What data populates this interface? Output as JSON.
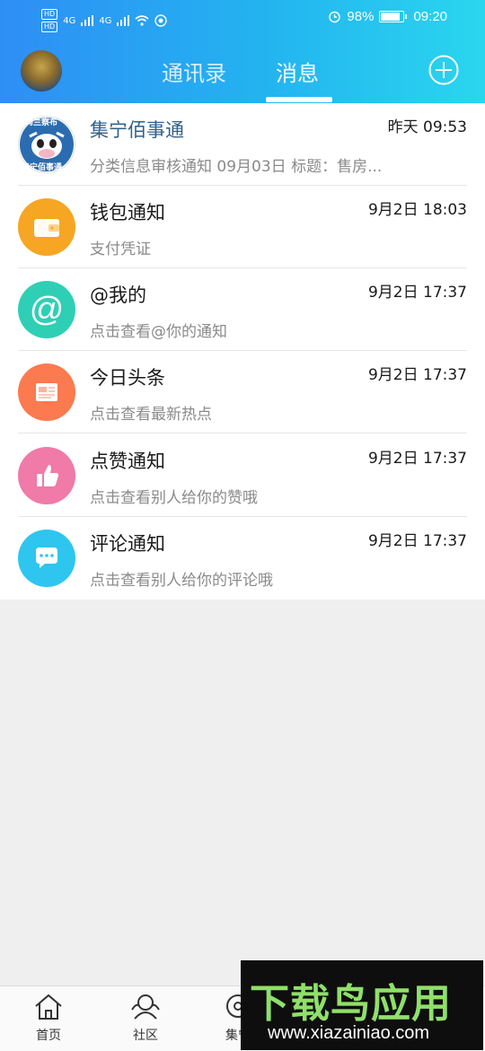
{
  "status_bar": {
    "network_labels": [
      "HD",
      "HD",
      "4G",
      "4G"
    ],
    "battery": "98%",
    "time": "09:20"
  },
  "header": {
    "tabs": [
      {
        "label": "通讯录",
        "active": false
      },
      {
        "label": "消息",
        "active": true
      }
    ]
  },
  "messages": [
    {
      "name": "集宁佰事通",
      "preview": "分类信息审核通知 09月03日 标题：售房...",
      "time": "昨天 09:53",
      "icon": "app-logo",
      "color": "#2b6cb0"
    },
    {
      "name": "钱包通知",
      "preview": "支付凭证",
      "time": "9月2日 18:03",
      "icon": "wallet-icon",
      "color": "#f6a623"
    },
    {
      "name": "@我的",
      "preview": "点击查看@你的通知",
      "time": "9月2日 17:37",
      "icon": "at-icon",
      "color": "#2fcfb5"
    },
    {
      "name": "今日头条",
      "preview": "点击查看最新热点",
      "time": "9月2日 17:37",
      "icon": "newspaper-icon",
      "color": "#fb7a4f"
    },
    {
      "name": "点赞通知",
      "preview": "点击查看别人给你的赞哦",
      "time": "9月2日 17:37",
      "icon": "thumbs-up-icon",
      "color": "#f07aa8"
    },
    {
      "name": "评论通知",
      "preview": "点击查看别人给你的评论哦",
      "time": "9月2日 17:37",
      "icon": "comment-icon",
      "color": "#2ec6ef"
    }
  ],
  "logo_text": {
    "top": "乌兰察布",
    "bottom": "集宁佰事通"
  },
  "bottom_nav": [
    {
      "label": "首页",
      "icon": "home-icon"
    },
    {
      "label": "社区",
      "icon": "community-icon"
    },
    {
      "label": "集宁",
      "icon": "city-icon"
    }
  ],
  "watermark": {
    "title": "下载鸟应用",
    "url": "www.xiazainiao.com"
  }
}
